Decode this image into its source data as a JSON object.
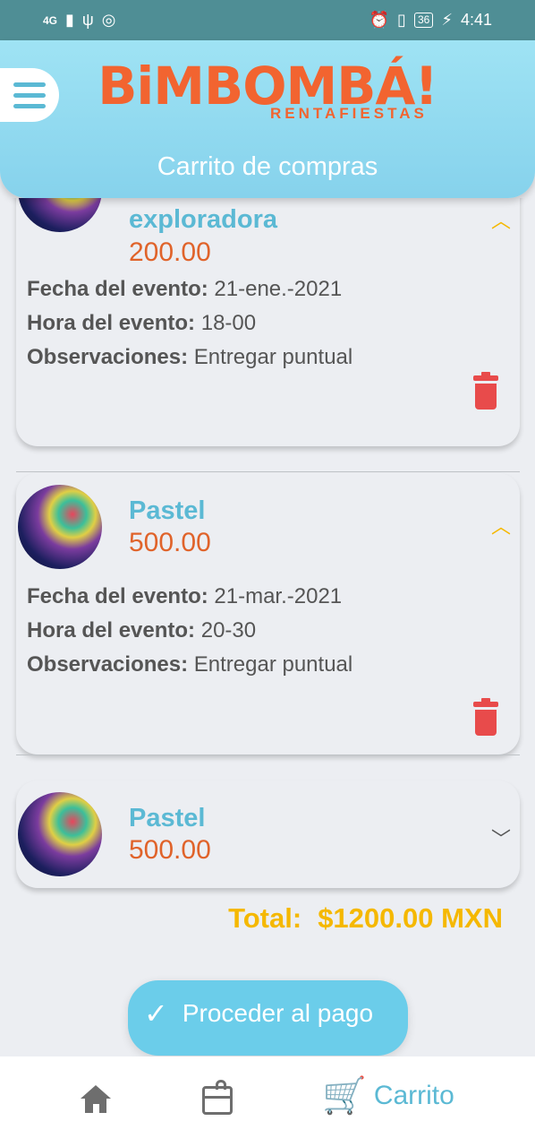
{
  "status_bar": {
    "network": "4G",
    "time": "4:41",
    "battery": "36"
  },
  "header": {
    "logo_main": "BiMBOMBÁ!",
    "logo_sub": "RENTAFIESTAS",
    "title": "Carrito de compras"
  },
  "items": [
    {
      "name": "exploradora",
      "price": "200.00",
      "date_label": "Fecha del evento:",
      "date": "21-ene.-2021",
      "hour_label": "Hora del evento:",
      "hour": "18-00",
      "notes_label": "Observaciones:",
      "notes": "Entregar puntual"
    },
    {
      "name": "Pastel",
      "price": "500.00",
      "date_label": "Fecha del evento:",
      "date": "21-mar.-2021",
      "hour_label": "Hora del evento:",
      "hour": "20-30",
      "notes_label": "Observaciones:",
      "notes": "Entregar puntual"
    },
    {
      "name": "Pastel",
      "price": "500.00"
    }
  ],
  "total": {
    "label": "Total:",
    "value": "$1200.00 MXN"
  },
  "pay_button": {
    "label": "Proceder al pago"
  },
  "bottom_nav": {
    "cart_label": "Carrito"
  },
  "colors": {
    "accent": "#5BB9D4",
    "price": "#E0632A",
    "total": "#F5B800",
    "delete": "#E84B4B",
    "header": "#8FD9F0"
  }
}
